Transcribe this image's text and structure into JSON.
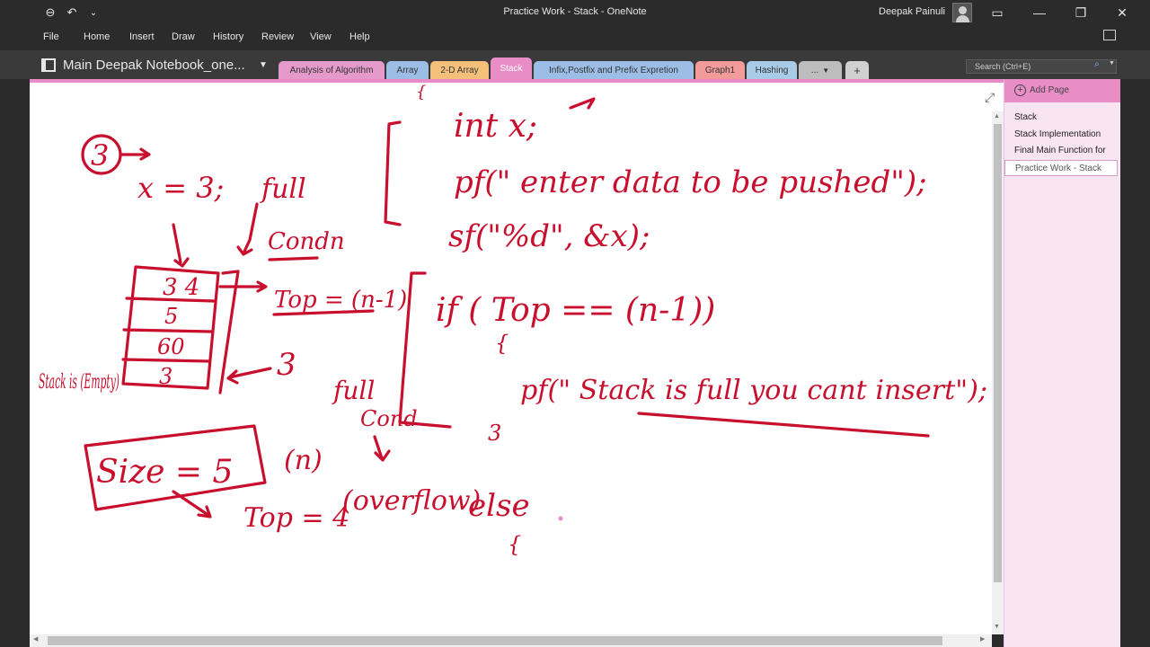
{
  "window": {
    "title": "Practice Work - Stack  -  OneNote",
    "user": "Deepak Painuli"
  },
  "menu": [
    "File",
    "Home",
    "Insert",
    "Draw",
    "History",
    "Review",
    "View",
    "Help"
  ],
  "notebook": {
    "name": "Main Deepak Notebook_one..."
  },
  "tabs": [
    {
      "label": "Analysis of Algorithm",
      "color": "#e59acb"
    },
    {
      "label": "Array",
      "color": "#9bbde6"
    },
    {
      "label": "2-D Array",
      "color": "#f5c07a"
    },
    {
      "label": "Stack",
      "color": "#e98dc6",
      "active": true
    },
    {
      "label": "Infix,Postfix and Prefix Expretion",
      "color": "#9bbde6"
    },
    {
      "label": "Graph1",
      "color": "#f39a9a"
    },
    {
      "label": "Hashing",
      "color": "#a8cbe8"
    },
    {
      "label": "...",
      "color": "#bdbdbd"
    },
    {
      "label": "+",
      "color": "#d0d0d0"
    }
  ],
  "search": {
    "placeholder": "Search (Ctrl+E)"
  },
  "pages": {
    "add_label": "Add Page",
    "items": [
      {
        "label": "Stack"
      },
      {
        "label": "Stack Implementation"
      },
      {
        "label": "Final Main Function for"
      },
      {
        "label": "Practice Work - Stack",
        "active": true
      }
    ]
  },
  "ink": {
    "code1": "int x;",
    "code2": "pf(\" enter data to be pushed\");",
    "code3": "sf(\"%d\", &x);",
    "code4": "if ( Top == (n-1))",
    "code5": "pf(\" Stack is full you cant insert\");",
    "circle3": "3",
    "xeq": "x = 3;",
    "full": "full",
    "condn": "Condn",
    "top_eq": "Top = (n-1)",
    "stack_cells": [
      "3 4",
      "5",
      "60",
      "3"
    ],
    "stack_label": "Stack is (Empty)",
    "arrow3": "3",
    "full2": "full",
    "cond2": "Cond",
    "size": "Size = 5",
    "n": "(n)",
    "top4": "Top = 4",
    "overflow": "(overflow)",
    "else": "else",
    "brace_open": "{",
    "brace_close": "3",
    "brace_else": "{",
    "brace_top": "{"
  },
  "colors": {
    "ink": "#c8102e",
    "accent": "#e98dc6"
  }
}
